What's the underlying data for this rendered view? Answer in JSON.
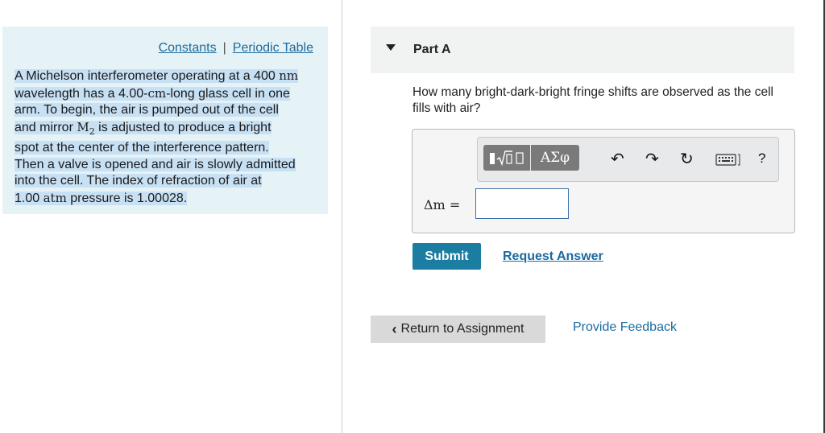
{
  "links": {
    "constants": "Constants",
    "separator": "|",
    "periodic_table": "Periodic Table"
  },
  "problem": {
    "l1_a": "A Michelson interferometer operating at a 400 ",
    "l1_unit": "nm",
    "l2": " wavelength has a 4.00-",
    "l2_unit": "cm",
    "l2_b": "-long glass cell in one",
    "l3": "arm. To begin, the air is pumped out of the cell",
    "l4_a": "and mirror ",
    "l4_m": "M",
    "l4_sub": "2",
    "l4_b": " is adjusted to produce a bright",
    "l5": "spot at the center of the interference pattern.",
    "l6": "Then a valve is opened and air is slowly admitted",
    "l7": "into the cell. The index of refraction of air at",
    "l8_a": "1.00 ",
    "l8_unit": "atm",
    "l8_b": " pressure is 1.00028."
  },
  "part": {
    "title": "Part A"
  },
  "question": "How many bright-dark-bright fringe shifts are observed as the cell fills with air?",
  "toolbar": {
    "templates_icon": "sqrt-template-icon",
    "greek_label": "ΑΣφ",
    "undo_icon": "undo-icon",
    "redo_icon": "redo-icon",
    "reset_icon": "reset-icon",
    "keyboard_icon": "keyboard-icon",
    "help_label": "?"
  },
  "answer": {
    "label": "Δm =",
    "value": ""
  },
  "buttons": {
    "submit": "Submit",
    "request_answer": "Request Answer",
    "return": "Return to Assignment",
    "feedback": "Provide Feedback"
  },
  "colors": {
    "panel_bg": "#e6f3f6",
    "link": "#1a6aa0",
    "submit_bg": "#1a7da1",
    "highlight": "#c7e0f4"
  }
}
